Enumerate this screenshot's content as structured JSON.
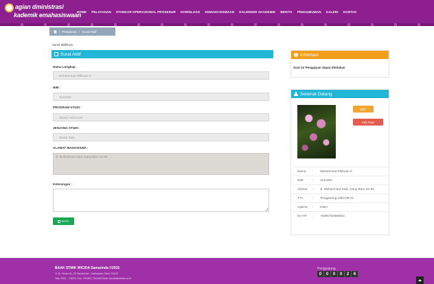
{
  "brand": {
    "line1": "agian  dministrasi",
    "line2": "kademik  emahasiswaan"
  },
  "nav": [
    "HOME",
    "PELAYANAN",
    "STANDAR OPERASIONAL PROSEDUR",
    "DOWNLOAD",
    "KEMAHASISWAAN",
    "KALENDER AKADEMIK",
    "BERITA",
    "PENGUMUMAN",
    "GALERI",
    "KONTAK"
  ],
  "breadcrumb": {
    "sep": "/",
    "level1": "Pelayanan",
    "level2": "Surat Aktif"
  },
  "page_heading": "surat aktifnya",
  "form": {
    "title": "Surat Aktif",
    "nama_label": "Nama Lengkap :",
    "nama_value": "Muhammad Ridhuan S",
    "nim_label": "NIM :",
    "nim_value": "1141053",
    "prodi_label": "PROGRAM STUDI :",
    "prodi_value": "Sistem Informasi",
    "jenjang_label": "JENJANG STUDI :",
    "jenjang_value": "Strata Satu",
    "alamat_label": "ALAMAT MAHASISWA :",
    "alamat_value": "Jl. Muhammad Said, Gang Baru No 60",
    "keterangan_label": "Keterangan :",
    "submit_label": "DATA"
  },
  "info": {
    "title": "Informasi",
    "text": "Soal ini Pengajuan dapat ditelakan"
  },
  "welcome": {
    "title": "Selamat Datang",
    "edit_label": "EDIT",
    "editpass_label": "Edit Pass",
    "nama_key": "Nama",
    "nama_val": "Muhammad Ridhuan S",
    "nim_key": "NIM",
    "nim_val": "1141053",
    "alamat_key": "Alamat",
    "alamat_val": "Jl. Muhammad Said, Gang Baru No 60",
    "ttl_key": "TTL",
    "ttl_val": "Tenggarong,1993-08-21",
    "agama_key": "Agama",
    "agama_val": "Islam",
    "hp_key": "No HP",
    "hp_val": "+6285752666932",
    "sep": ":"
  },
  "footer": {
    "title": "BAAK STMIK WICIDA Samarinda ©2015",
    "address": "Jl. M. Yamin No. 25 Samarinda - Kalimantan Timur 75123",
    "contact": "Telp. 0541 - 736071 Fax. 203482, 734448 Email: wicida@wicida.ac.id",
    "counter_label": "Pengunjung",
    "counter_digits": [
      "0",
      "0",
      "0",
      "0",
      "2",
      "6"
    ]
  }
}
